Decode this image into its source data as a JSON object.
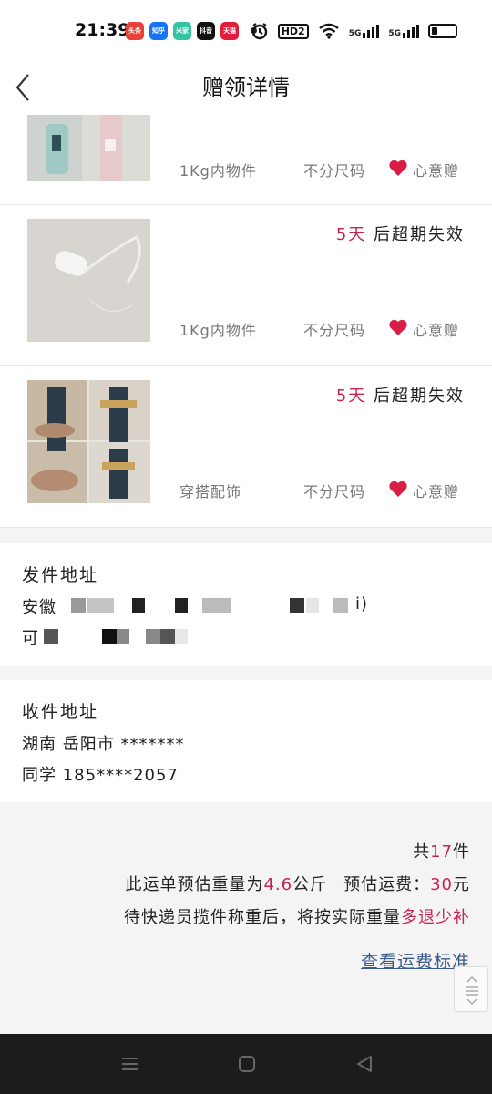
{
  "status_bar": {
    "time": "21:39",
    "apps": [
      {
        "label": "头条",
        "color": "#e8413c"
      },
      {
        "label": "知乎",
        "color": "#1772f6"
      },
      {
        "label": "米家",
        "color": "#33c4a4"
      },
      {
        "label": "抖音",
        "color": "#111111"
      },
      {
        "label": "天猫",
        "color": "#e01e3c"
      }
    ],
    "icons": [
      "alarm-icon",
      "hd-icon",
      "wifi-icon",
      "5g-signal-icon",
      "5g-signal-icon-2",
      "battery-icon"
    ],
    "hd_label": "HD2",
    "net1": "5G",
    "net2": "5G"
  },
  "nav": {
    "title": "赠领详情"
  },
  "items": [
    {
      "expire_days": "",
      "expire_suffix": "",
      "category": "1Kg内物件",
      "size": "不分尺码",
      "tag": "心意赠"
    },
    {
      "expire_days": "5天",
      "expire_suffix": " 后超期失效",
      "category": "1Kg内物件",
      "size": "不分尺码",
      "tag": "心意赠"
    },
    {
      "expire_days": "5天",
      "expire_suffix": " 后超期失效",
      "category": "穿搭配饰",
      "size": "不分尺码",
      "tag": "心意赠"
    }
  ],
  "sender": {
    "heading": "发件地址",
    "line1_prefix": "安徽",
    "line1_tail": "i)",
    "line2_prefix": "可"
  },
  "receiver": {
    "heading": "收件地址",
    "line1": "湖南 岳阳市 *******",
    "line2": "同学 185****2057"
  },
  "summary": {
    "count_prefix": "共",
    "count": "17",
    "count_suffix": "件",
    "weight_prefix": "此运单预估重量为",
    "weight": "4.6",
    "weight_unit": "公斤",
    "fee_prefix": "预估运费：",
    "fee": "30",
    "fee_unit": "元",
    "note_prefix": "待快递员揽件称重后，将按实际重量",
    "note_highlight": "多退少补",
    "link": "查看运费标准"
  },
  "colors": {
    "accent": "#c8234d",
    "link": "#3a5a8c"
  }
}
